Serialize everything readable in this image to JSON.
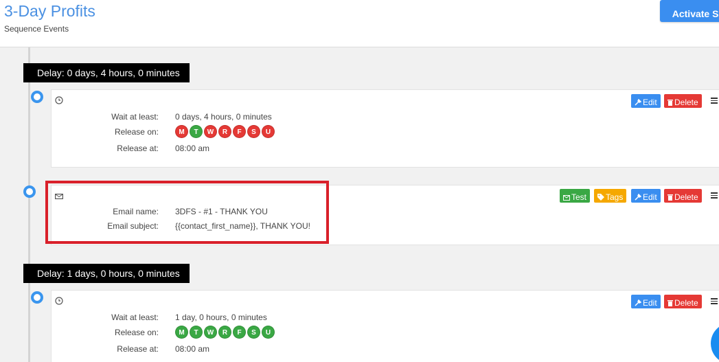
{
  "header": {
    "title": "3-Day Profits",
    "subtitle": "Sequence Events",
    "activate_label": "Activate Se"
  },
  "buttons": {
    "edit": "Edit",
    "delete": "Delete",
    "test": "Test",
    "tags": "Tags"
  },
  "colors": {
    "accent": "#3a8ef0",
    "danger": "#e53935",
    "success": "#3aa844",
    "warning": "#f5a800",
    "highlight": "#d9202a"
  },
  "events": [
    {
      "delay_label": "Delay: 0 days, 4 hours, 0 minutes",
      "icon": "clock-icon",
      "wait_label": "Wait at least:",
      "wait_value": "0 days, 4 hours, 0 minutes",
      "release_on_label": "Release on:",
      "days": [
        {
          "letter": "M",
          "active": false
        },
        {
          "letter": "T",
          "active": true
        },
        {
          "letter": "W",
          "active": false
        },
        {
          "letter": "R",
          "active": false
        },
        {
          "letter": "F",
          "active": false
        },
        {
          "letter": "S",
          "active": false
        },
        {
          "letter": "U",
          "active": false
        }
      ],
      "release_at_label": "Release at:",
      "release_at_value": "08:00 am"
    },
    {
      "icon": "envelope-icon",
      "email_name_label": "Email name:",
      "email_name_value": "3DFS - #1 - THANK YOU",
      "email_subject_label": "Email subject:",
      "email_subject_value": "{{contact_first_name}}, THANK YOU!"
    },
    {
      "delay_label": "Delay: 1 days, 0 hours, 0 minutes",
      "icon": "clock-icon",
      "wait_label": "Wait at least:",
      "wait_value": "1 day, 0 hours, 0 minutes",
      "release_on_label": "Release on:",
      "days": [
        {
          "letter": "M",
          "active": true
        },
        {
          "letter": "T",
          "active": true
        },
        {
          "letter": "W",
          "active": true
        },
        {
          "letter": "R",
          "active": true
        },
        {
          "letter": "F",
          "active": true
        },
        {
          "letter": "S",
          "active": true
        },
        {
          "letter": "U",
          "active": true
        }
      ],
      "release_at_label": "Release at:",
      "release_at_value": "08:00 am"
    }
  ]
}
